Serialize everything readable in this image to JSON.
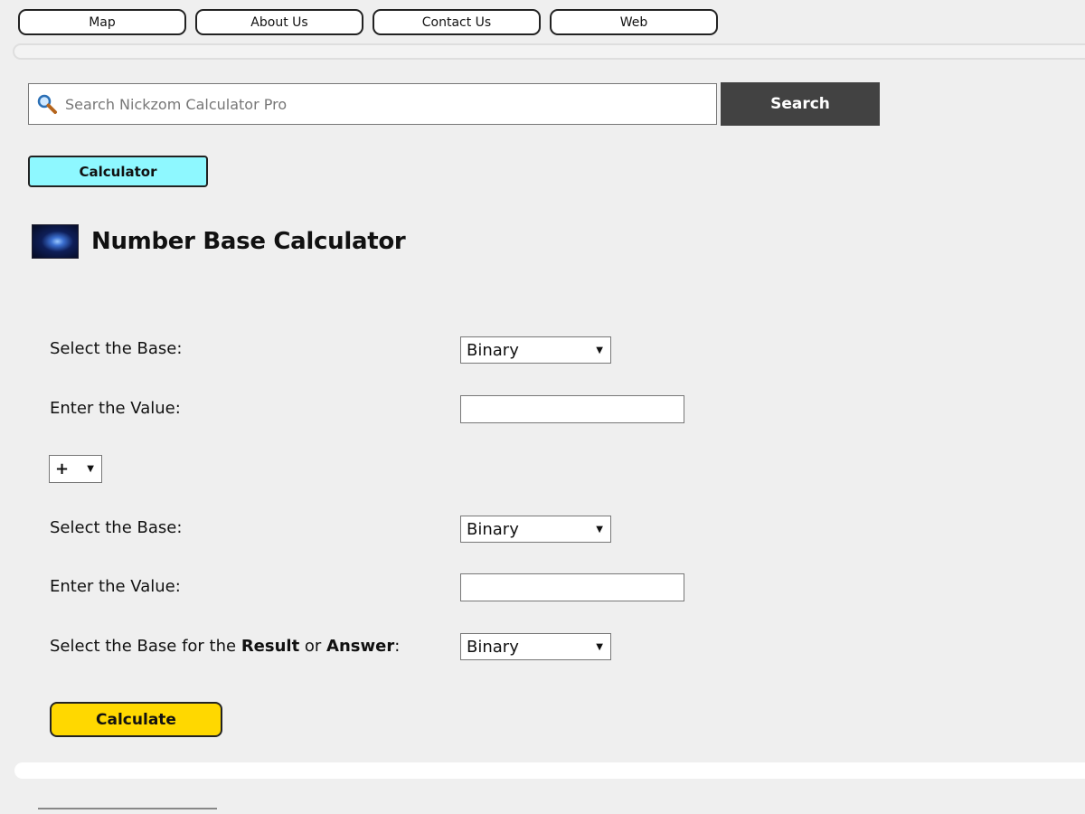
{
  "nav": {
    "items": [
      {
        "label": "Map"
      },
      {
        "label": "About Us"
      },
      {
        "label": "Contact Us"
      },
      {
        "label": "Web"
      }
    ]
  },
  "search": {
    "placeholder": "Search Nickzom Calculator Pro",
    "value": "",
    "button_label": "Search"
  },
  "category": {
    "label": "Calculator"
  },
  "page": {
    "title": "Number Base Calculator"
  },
  "form": {
    "base1_label": "Select the Base:",
    "base1_value": "Binary",
    "value1_label": "Enter the Value:",
    "value1": "",
    "operator_value": "+",
    "base2_label": "Select the Base:",
    "base2_value": "Binary",
    "value2_label": "Enter the Value:",
    "value2": "",
    "result_label_prefix": "Select the Base for the ",
    "result_label_result": "Result",
    "result_label_or": " or ",
    "result_label_answer": "Answer",
    "result_label_suffix": ":",
    "result_base_value": "Binary",
    "calculate_label": "Calculate"
  },
  "colors": {
    "background": "#efefef",
    "search_button": "#424242",
    "calculator_tag": "#8ef8ff",
    "calculate_button": "#ffd800"
  }
}
